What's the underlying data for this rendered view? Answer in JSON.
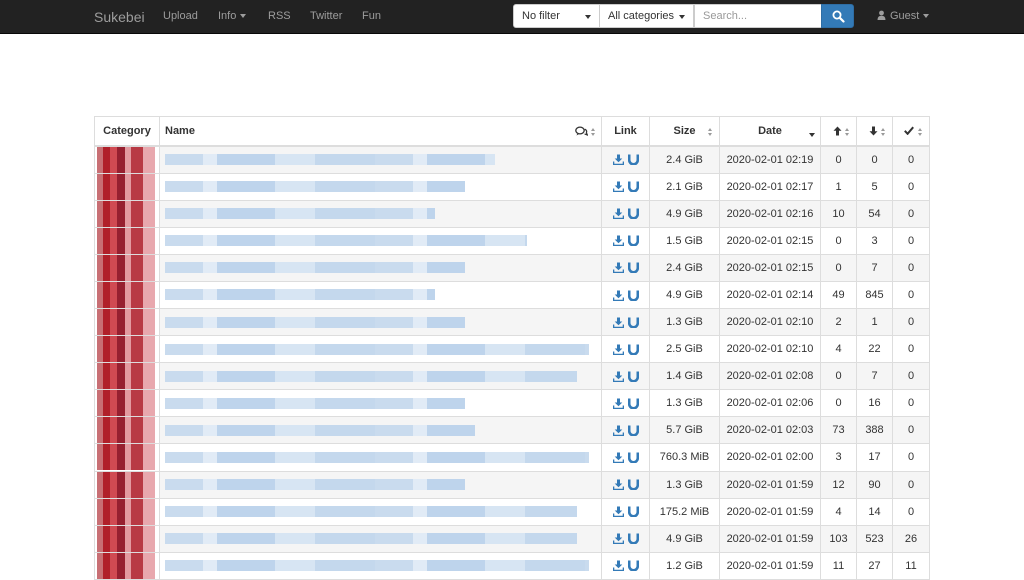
{
  "navbar": {
    "brand": "Sukebei",
    "links": {
      "upload": "Upload",
      "info": "Info",
      "rss": "RSS",
      "twitter": "Twitter",
      "fun": "Fun"
    },
    "filter": "No filter",
    "category": "All categories",
    "search_placeholder": "Search...",
    "guest": "Guest"
  },
  "table": {
    "headers": {
      "category": "Category",
      "name": "Name",
      "link": "Link",
      "size": "Size",
      "date": "Date"
    },
    "rows": [
      {
        "size": "2.4 GiB",
        "date": "2020-02-01 02:19",
        "seeders": "0",
        "leechers": "0",
        "completed": "0",
        "name_width": 330
      },
      {
        "size": "2.1 GiB",
        "date": "2020-02-01 02:17",
        "seeders": "1",
        "leechers": "5",
        "completed": "0",
        "name_width": 300
      },
      {
        "size": "4.9 GiB",
        "date": "2020-02-01 02:16",
        "seeders": "10",
        "leechers": "54",
        "completed": "0",
        "name_width": 270
      },
      {
        "size": "1.5 GiB",
        "date": "2020-02-01 02:15",
        "seeders": "0",
        "leechers": "3",
        "completed": "0",
        "name_width": 362
      },
      {
        "size": "2.4 GiB",
        "date": "2020-02-01 02:15",
        "seeders": "0",
        "leechers": "7",
        "completed": "0",
        "name_width": 300
      },
      {
        "size": "4.9 GiB",
        "date": "2020-02-01 02:14",
        "seeders": "49",
        "leechers": "845",
        "completed": "0",
        "name_width": 270
      },
      {
        "size": "1.3 GiB",
        "date": "2020-02-01 02:10",
        "seeders": "2",
        "leechers": "1",
        "completed": "0",
        "name_width": 300
      },
      {
        "size": "2.5 GiB",
        "date": "2020-02-01 02:10",
        "seeders": "4",
        "leechers": "22",
        "completed": "0",
        "name_width": 424
      },
      {
        "size": "1.4 GiB",
        "date": "2020-02-01 02:08",
        "seeders": "0",
        "leechers": "7",
        "completed": "0",
        "name_width": 412
      },
      {
        "size": "1.3 GiB",
        "date": "2020-02-01 02:06",
        "seeders": "0",
        "leechers": "16",
        "completed": "0",
        "name_width": 300
      },
      {
        "size": "5.7 GiB",
        "date": "2020-02-01 02:03",
        "seeders": "73",
        "leechers": "388",
        "completed": "0",
        "name_width": 310
      },
      {
        "size": "760.3 MiB",
        "date": "2020-02-01 02:00",
        "seeders": "3",
        "leechers": "17",
        "completed": "0",
        "name_width": 424
      },
      {
        "size": "1.3 GiB",
        "date": "2020-02-01 01:59",
        "seeders": "12",
        "leechers": "90",
        "completed": "0",
        "name_width": 300
      },
      {
        "size": "175.2 MiB",
        "date": "2020-02-01 01:59",
        "seeders": "4",
        "leechers": "14",
        "completed": "0",
        "name_width": 412
      },
      {
        "size": "4.9 GiB",
        "date": "2020-02-01 01:59",
        "seeders": "103",
        "leechers": "523",
        "completed": "26",
        "name_width": 412
      },
      {
        "size": "1.2 GiB",
        "date": "2020-02-01 01:59",
        "seeders": "11",
        "leechers": "27",
        "completed": "11",
        "name_width": 424
      }
    ]
  },
  "colors": {
    "navbar": "#222222",
    "primary": "#337ab7",
    "seeders": "#008000",
    "leechers": "#d9534f"
  },
  "icons": {
    "comments": "comments-icon",
    "seeders": "arrow-up-icon",
    "leechers": "arrow-down-icon",
    "completed": "check-icon",
    "download": "download-icon",
    "magnet": "magnet-icon",
    "search": "search-icon",
    "user": "user-icon"
  }
}
